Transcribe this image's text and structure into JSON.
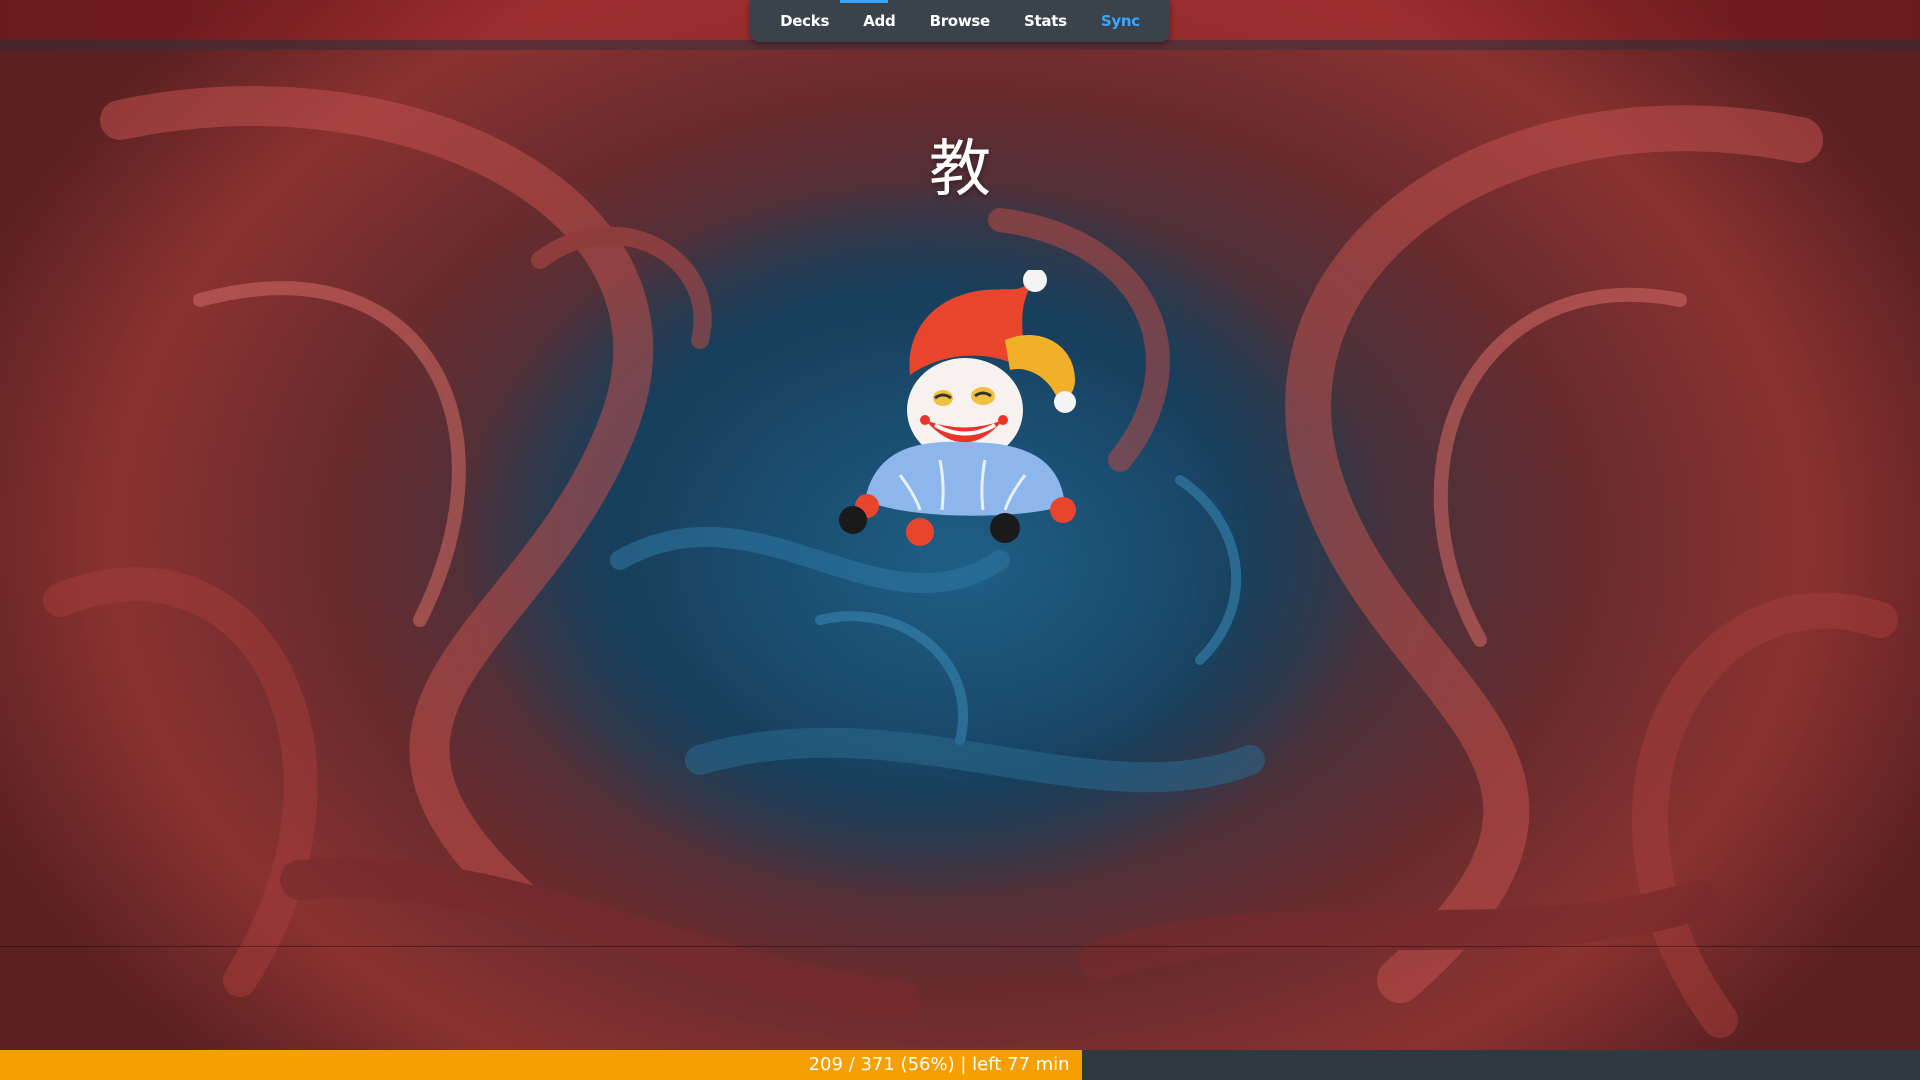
{
  "toolbar": {
    "tabs": [
      {
        "label": "Decks",
        "active": false
      },
      {
        "label": "Add",
        "active": false
      },
      {
        "label": "Browse",
        "active": false
      },
      {
        "label": "Stats",
        "active": false
      },
      {
        "label": "Sync",
        "active": true
      }
    ],
    "accent_color": "#3aa6ff"
  },
  "card": {
    "front_text": "教",
    "image_icon": "jester-doll-icon"
  },
  "progress": {
    "done": 209,
    "total": 371,
    "percent": 56,
    "text": "209 / 371 (56%) | left 77 min",
    "fill_color": "#f5a000"
  }
}
